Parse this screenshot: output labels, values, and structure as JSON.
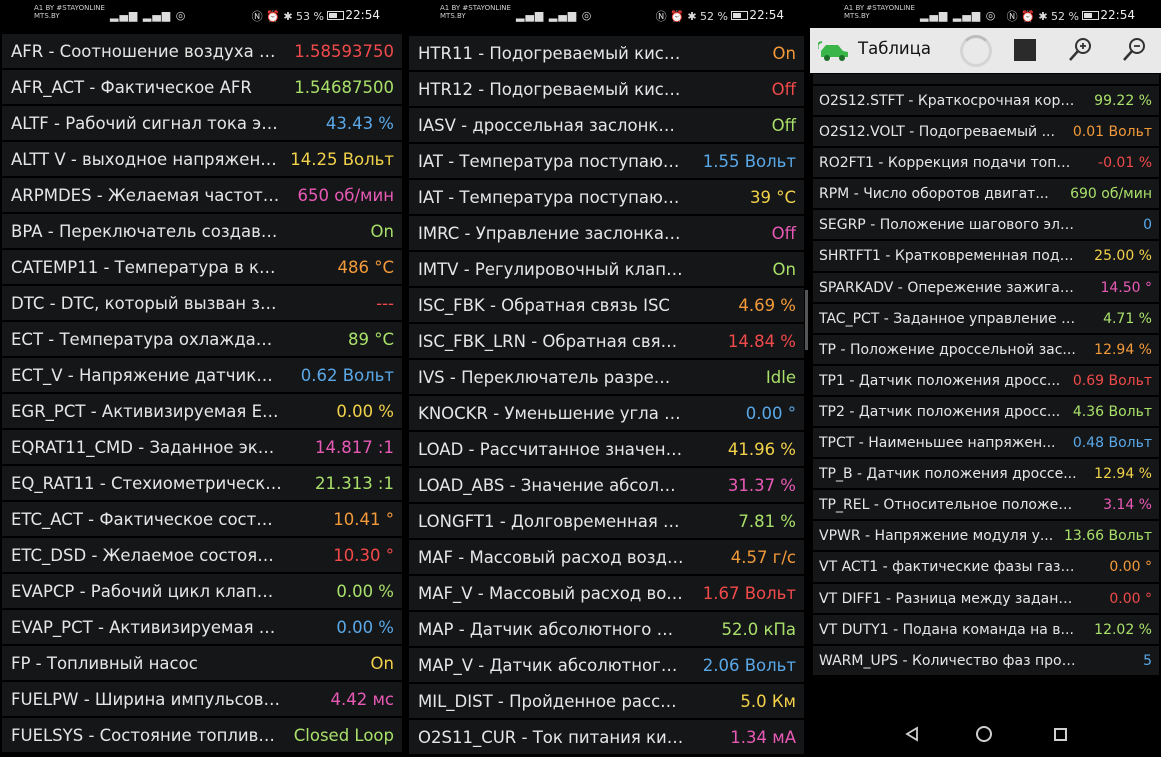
{
  "app": {
    "title": "Таблица"
  },
  "colors": {
    "red": "#f04a4a",
    "green": "#a9e06a",
    "blue": "#5aa8e8",
    "yellow": "#f2d24a",
    "orange": "#f29a3a",
    "pink": "#e85ab6",
    "white": "#e6e6e6"
  },
  "panels": [
    {
      "status": {
        "carrier_line1": "A1 BY #STAYONLINE",
        "carrier_line2": "MTS.BY",
        "battery": "53 %",
        "time": "22:54"
      },
      "rows": [
        {
          "label": "AFR - Соотношение воздуха и...",
          "value": "1.58593750",
          "color": "#f04a4a"
        },
        {
          "label": "AFR_ACT - Фактическое AFR",
          "value": "1.54687500",
          "color": "#a9e06a"
        },
        {
          "label": "ALTF - Рабочий сигнал тока элект...",
          "value": "43.43 %",
          "color": "#5aa8e8"
        },
        {
          "label": "ALTT V - выходное напряжени...",
          "value": "14.25 Вольт",
          "color": "#f2d24a"
        },
        {
          "label": "ARPMDES - Желаемая частота...",
          "value": "650 об/мин",
          "color": "#e85ab6"
        },
        {
          "label": "BPA - Переключатель создаваемого да...",
          "value": "On",
          "color": "#a9e06a"
        },
        {
          "label": "CATEMP11 - Температура в катали...",
          "value": "486 °C",
          "color": "#f29a3a"
        },
        {
          "label": "DTC - DTC, который вызван запросом с...",
          "value": "---",
          "color": "#f04a4a"
        },
        {
          "label": "ECT - Температура охлаждающей ж...",
          "value": "89 °C",
          "color": "#a9e06a"
        },
        {
          "label": "ECT_V - Напряжение датчика т...",
          "value": "0.62 Вольт",
          "color": "#5aa8e8"
        },
        {
          "label": "EGR_PCT - Активизируемая EGR",
          "value": "0.00 %",
          "color": "#f2d24a"
        },
        {
          "label": "EQRAT11_CMD - Заданное эквив...",
          "value": "14.817 :1",
          "color": "#e85ab6"
        },
        {
          "label": "EQ_RAT11 - Стехиометрическое ...",
          "value": "21.313 :1",
          "color": "#a9e06a"
        },
        {
          "label": "ETC_ACT - Фактическое состояние ...",
          "value": "10.41 °",
          "color": "#f29a3a"
        },
        {
          "label": "ETC_DSD - Желаемое состояние эл...",
          "value": "10.30 °",
          "color": "#f04a4a"
        },
        {
          "label": "EVAPCP - Рабочий цикл клапана в...",
          "value": "0.00 %",
          "color": "#a9e06a"
        },
        {
          "label": "EVAP_PCT - Активизируемая очист...",
          "value": "0.00 %",
          "color": "#5aa8e8"
        },
        {
          "label": "FP - Топливный насос",
          "value": "On",
          "color": "#f2d24a"
        },
        {
          "label": "FUELPW - Ширина импульсов топ...",
          "value": "4.42 мс",
          "color": "#e85ab6"
        },
        {
          "label": "FUELSYS - Состояние топливн...",
          "value": "Closed Loop",
          "color": "#a9e06a"
        }
      ]
    },
    {
      "status": {
        "carrier_line1": "A1 BY #STAYONLINE",
        "carrier_line2": "MTS.BY",
        "battery": "52 %",
        "time": "22:54"
      },
      "rows": [
        {
          "label": "HTR11 - Подогреваемый кислородный ...",
          "value": "On",
          "color": "#f29a3a"
        },
        {
          "label": "HTR12 - Подогреваемый кислородный...",
          "value": "Off",
          "color": "#f04a4a"
        },
        {
          "label": "IASV - дроссельная заслонка системы ...",
          "value": "Off",
          "color": "#a9e06a"
        },
        {
          "label": "IAT - Температура поступающе...",
          "value": "1.55 Вольт",
          "color": "#5aa8e8"
        },
        {
          "label": "IAT - Температура поступающего во...",
          "value": "39 °C",
          "color": "#f2d24a"
        },
        {
          "label": "IMRC - Управление заслонками канал...",
          "value": "Off",
          "color": "#e85ab6"
        },
        {
          "label": "IMTV - Регулировочный клапан впускн...",
          "value": "On",
          "color": "#a9e06a"
        },
        {
          "label": "ISC_FBK - Обратная связь ISC",
          "value": "4.69 %",
          "color": "#f29a3a"
        },
        {
          "label": "ISC_FBK_LRN - Обратная связь ISC ...",
          "value": "14.84 %",
          "color": "#f04a4a"
        },
        {
          "label": "IVS - Переключатель разрешения оце...",
          "value": "Idle",
          "color": "#a9e06a"
        },
        {
          "label": "KNOCKR - Уменьшение угла опереж...",
          "value": "0.00 °",
          "color": "#5aa8e8"
        },
        {
          "label": "LOAD - Рассчитанное значение на...",
          "value": "41.96 %",
          "color": "#f2d24a"
        },
        {
          "label": "LOAD_ABS - Значение абсолютной...",
          "value": "31.37 %",
          "color": "#e85ab6"
        },
        {
          "label": "LONGFT1 - Долговременная подстр...",
          "value": "7.81 %",
          "color": "#a9e06a"
        },
        {
          "label": "MAF - Массовый расход воздуха",
          "value": "4.57 г/с",
          "color": "#f29a3a"
        },
        {
          "label": "MAF_V - Массовый расход воз...",
          "value": "1.67 Вольт",
          "color": "#f04a4a"
        },
        {
          "label": "MAP - Датчик абсолютного давл...",
          "value": "52.0 кПа",
          "color": "#a9e06a"
        },
        {
          "label": "MAP_V - Датчик абсолютного ...",
          "value": "2.06 Вольт",
          "color": "#5aa8e8"
        },
        {
          "label": "MIL_DIST - Пройденное расстояние...",
          "value": "5.0 Км",
          "color": "#f2d24a"
        },
        {
          "label": "O2S11_CUR - Ток питания кислор...",
          "value": "1.34 мА",
          "color": "#e85ab6"
        }
      ]
    },
    {
      "status": {
        "carrier_line1": "A1 BY #STAYONLINE",
        "carrier_line2": "MTS.BY",
        "battery": "52 %",
        "time": "22:54"
      },
      "rows": [
        {
          "label": "O2S12.STFT - Краткосрочная корр...",
          "value": "99.22 %",
          "color": "#a9e06a"
        },
        {
          "label": "O2S12.VOLT - Подогреваемый ...",
          "value": "0.01 Вольт",
          "color": "#f29a3a"
        },
        {
          "label": "RO2FT1 - Коррекция подачи топли...",
          "value": "-0.01 %",
          "color": "#f04a4a"
        },
        {
          "label": "RPM - Число оборотов двигат...",
          "value": "690 об/мин",
          "color": "#a9e06a"
        },
        {
          "label": "SEGRP - Положение шагового электрод...",
          "value": "0",
          "color": "#5aa8e8"
        },
        {
          "label": "SHRTFT1 - Кратковременная подс...",
          "value": "25.00 %",
          "color": "#f2d24a"
        },
        {
          "label": "SPARKADV - Опережение зажигания",
          "value": "14.50 °",
          "color": "#e85ab6"
        },
        {
          "label": "TAC_PCT - Заданное управление ис...",
          "value": "4.71 %",
          "color": "#a9e06a"
        },
        {
          "label": "TP - Положение дроссельной зас...",
          "value": "12.94 %",
          "color": "#f29a3a"
        },
        {
          "label": "TP1 - Датчик положения дросс...",
          "value": "0.69 Вольт",
          "color": "#f04a4a"
        },
        {
          "label": "TP2 - Датчик положения дросс...",
          "value": "4.36 Вольт",
          "color": "#a9e06a"
        },
        {
          "label": "TPCT - Наименьшее напряжен...",
          "value": "0.48 Вольт",
          "color": "#5aa8e8"
        },
        {
          "label": "TP_B - Датчик положения дроссе...",
          "value": "12.94 %",
          "color": "#f2d24a"
        },
        {
          "label": "TP_REL - Относительное положение...",
          "value": "3.14 %",
          "color": "#e85ab6"
        },
        {
          "label": "VPWR - Напряжение модуля у...",
          "value": "13.66 Вольт",
          "color": "#a9e06a"
        },
        {
          "label": "VT ACT1 - фактические фазы газора...",
          "value": "0.00 °",
          "color": "#f29a3a"
        },
        {
          "label": "VT DIFF1 - Разница между заданным...",
          "value": "0.00 °",
          "color": "#f04a4a"
        },
        {
          "label": "VT DUTY1 - Подана команда на в...",
          "value": "12.02 %",
          "color": "#a9e06a"
        },
        {
          "label": "WARM_UPS - Количество фаз прогрева ...",
          "value": "5",
          "color": "#5aa8e8"
        }
      ]
    }
  ]
}
